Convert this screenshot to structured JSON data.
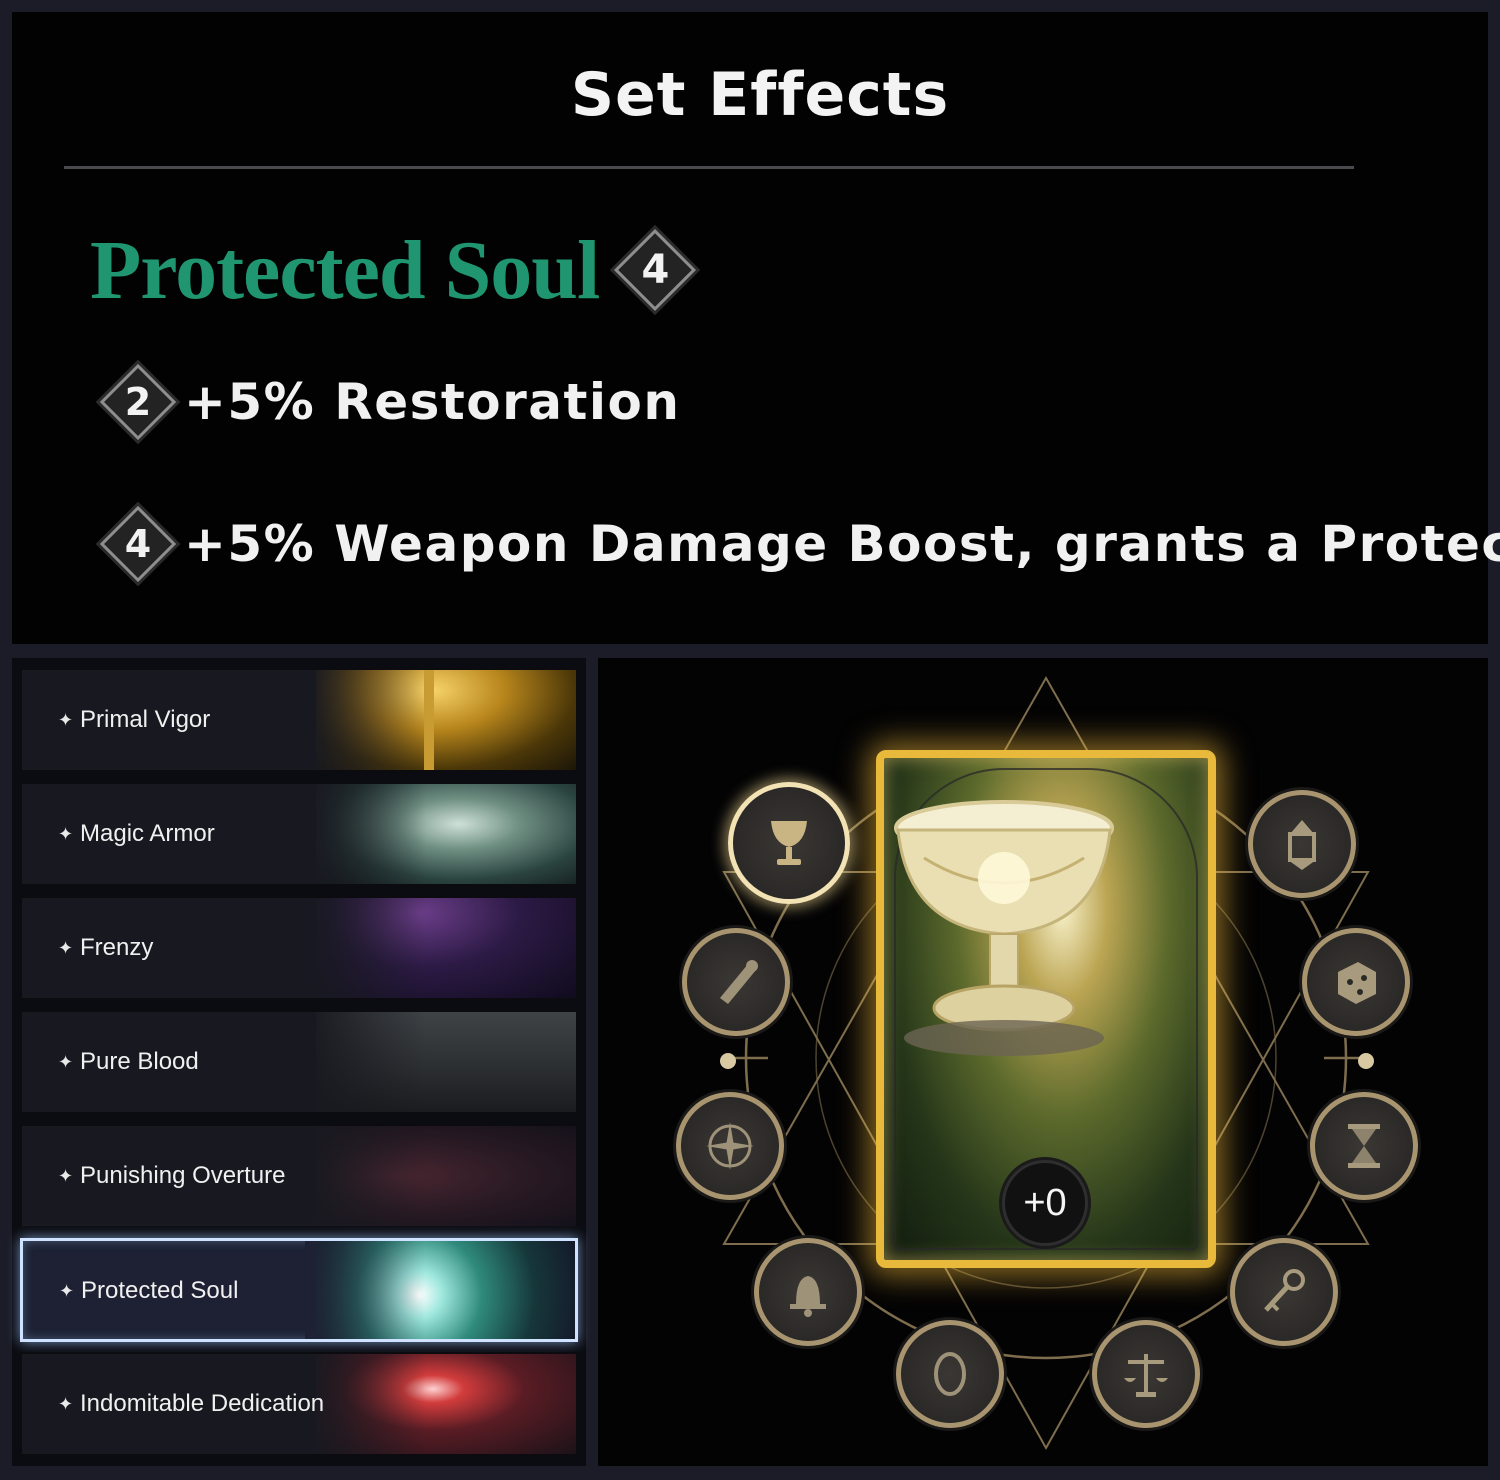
{
  "set_effects": {
    "title": "Set Effects",
    "set_name": "Protected Soul",
    "set_count": "4",
    "effects": [
      {
        "pieces": "2",
        "text": "+5% Restoration"
      },
      {
        "pieces": "4",
        "text": "+5% Weapon Damage Boost, grants a Protec..."
      }
    ]
  },
  "set_list": {
    "items": [
      {
        "label": "Primal Vigor",
        "selected": false
      },
      {
        "label": "Magic Armor",
        "selected": false
      },
      {
        "label": "Frenzy",
        "selected": false
      },
      {
        "label": "Pure Blood",
        "selected": false
      },
      {
        "label": "Punishing Overture",
        "selected": false
      },
      {
        "label": "Protected Soul",
        "selected": true
      },
      {
        "label": "Indomitable Dedication",
        "selected": false
      }
    ],
    "bullet": "✦"
  },
  "card": {
    "level": "+0",
    "art": "chalice",
    "slots": [
      {
        "icon": "chalice-icon",
        "active": true
      },
      {
        "icon": "lantern-icon",
        "active": false
      },
      {
        "icon": "scroll-icon",
        "active": false
      },
      {
        "icon": "dice-icon",
        "active": false
      },
      {
        "icon": "compass-icon",
        "active": false
      },
      {
        "icon": "hourglass-icon",
        "active": false
      },
      {
        "icon": "bell-icon",
        "active": false
      },
      {
        "icon": "key-icon",
        "active": false
      },
      {
        "icon": "mirror-icon",
        "active": false
      },
      {
        "icon": "scales-icon",
        "active": false
      }
    ]
  },
  "colors": {
    "set_name": "#1f9670",
    "frame_gold": "#e8b93a",
    "selected_border": "#cfe2ff"
  }
}
